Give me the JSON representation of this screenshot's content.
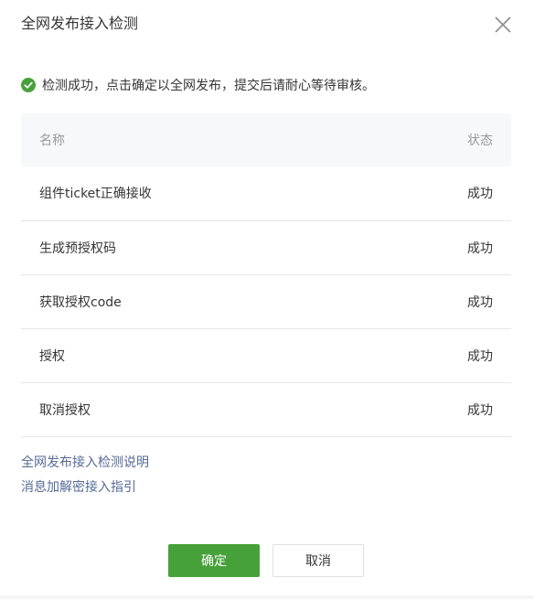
{
  "dialog": {
    "title": "全网发布接入检测",
    "close_icon": "close-icon"
  },
  "notice": {
    "icon": "check-circle-icon",
    "icon_color": "#47a13a",
    "text": "检测成功，点击确定以全网发布，提交后请耐心等待审核。"
  },
  "table": {
    "headers": {
      "name": "名称",
      "status": "状态"
    },
    "rows": [
      {
        "name": "组件ticket正确接收",
        "status": "成功"
      },
      {
        "name": "生成预授权码",
        "status": "成功"
      },
      {
        "name": "获取授权code",
        "status": "成功"
      },
      {
        "name": "授权",
        "status": "成功"
      },
      {
        "name": "取消授权",
        "status": "成功"
      }
    ]
  },
  "links": {
    "detection_guide": "全网发布接入检测说明",
    "encryption_guide": "消息加解密接入指引"
  },
  "buttons": {
    "confirm": "确定",
    "cancel": "取消"
  },
  "colors": {
    "primary": "#47a13a",
    "link": "#576b95"
  }
}
